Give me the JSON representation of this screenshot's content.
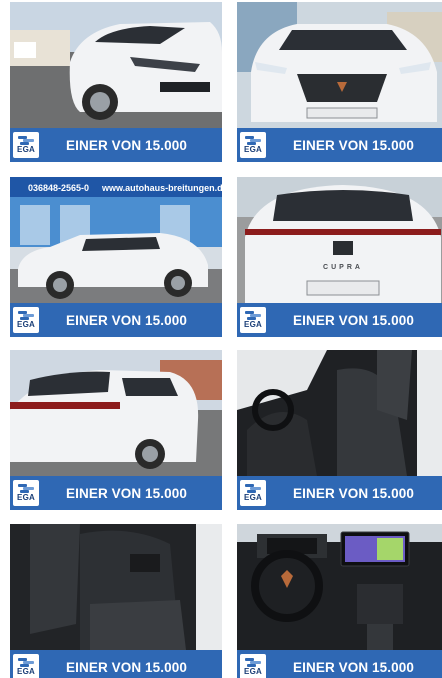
{
  "gallery": {
    "tiles": [
      {
        "caption": "EINER VON 15.000",
        "badge": "EGA",
        "scene": "front-left-exterior"
      },
      {
        "caption": "EINER VON 15.000",
        "badge": "EGA",
        "scene": "front-exterior"
      },
      {
        "caption": "EINER VON 15.000",
        "badge": "EGA",
        "scene": "side-profile-dealership",
        "sign_phone": "036848-2565-0",
        "sign_url": "www.autohaus-breitungen.de"
      },
      {
        "caption": "EINER VON 15.000",
        "badge": "EGA",
        "scene": "rear-exterior",
        "rear_badge": "CUPRA"
      },
      {
        "caption": "EINER VON 15.000",
        "badge": "EGA",
        "scene": "rear-left-exterior"
      },
      {
        "caption": "EINER VON 15.000",
        "badge": "EGA",
        "scene": "front-seats-interior"
      },
      {
        "caption": "EINER VON 15.000",
        "badge": "EGA",
        "scene": "rear-seats-interior"
      },
      {
        "caption": "EINER VON 15.000",
        "badge": "EGA",
        "scene": "dashboard-interior"
      }
    ]
  },
  "colors": {
    "banner": "#2f68b4",
    "caption_text": "#ffffff",
    "car_body": "#f2f3f5"
  }
}
